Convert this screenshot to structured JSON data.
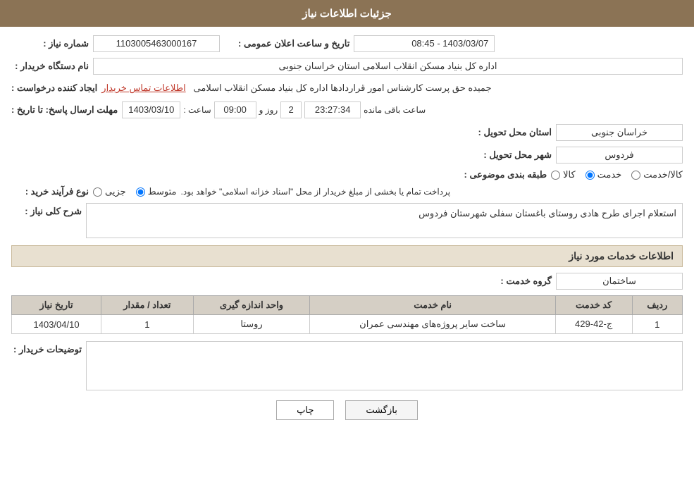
{
  "header": {
    "title": "جزئیات اطلاعات نیاز"
  },
  "fields": {
    "shomara_niaz_label": "شماره نیاز :",
    "shomara_niaz_value": "1103005463000167",
    "nam_dastgah_label": "نام دستگاه خریدار :",
    "nam_dastgah_value": "اداره کل بنیاد مسکن انقلاب اسلامی استان خراسان جنوبی",
    "ijad_konande_label": "ایجاد کننده درخواست :",
    "ijad_konande_value": "جمیده حق پرست کارشناس امور قراردادها اداره کل بنیاد مسکن انقلاب اسلامی",
    "ettelaat_tamas_label": "اطلاعات تماس خریدار",
    "tarikh_elan_label": "تاریخ و ساعت اعلان عمومی :",
    "tarikh_elan_value": "1403/03/07 - 08:45",
    "mohlat_label": "مهلت ارسال پاسخ: تا تاریخ :",
    "mohlat_date": "1403/03/10",
    "mohlat_saat_label": "ساعت :",
    "mohlat_saat": "09:00",
    "mohlat_rooz_label": "روز و",
    "mohlat_rooz": "2",
    "mohlat_baqi_label": "ساعت باقی مانده",
    "mohlat_baqi": "23:27:34",
    "ostan_label": "استان محل تحویل :",
    "ostan_value": "خراسان جنوبی",
    "shahr_label": "شهر محل تحویل :",
    "shahr_value": "فردوس",
    "tabaqe_label": "طبقه بندی موضوعی :",
    "tabaqe_options": [
      "کالا",
      "خدمت",
      "کالا/خدمت"
    ],
    "tabaqe_selected": "خدمت",
    "noع_farayand_label": "نوع فرآیند خرید :",
    "noع_farayand_options": [
      "جزیی",
      "متوسط"
    ],
    "noع_farayand_selected": "متوسط",
    "noع_farayand_desc": "پرداخت تمام یا بخشی از مبلغ خریدار از محل \"اسناد خزانه اسلامی\" خواهد بود.",
    "sharh_label": "شرح کلی نیاز :",
    "sharh_value": "استعلام اجرای طرح هادی روستای باغستان سفلی شهرستان فردوس",
    "khadamat_section": "اطلاعات خدمات مورد نیاز",
    "goroh_label": "گروه خدمت :",
    "goroh_value": "ساختمان",
    "table": {
      "headers": [
        "ردیف",
        "کد خدمت",
        "نام خدمت",
        "واحد اندازه گیری",
        "تعداد / مقدار",
        "تاریخ نیاز"
      ],
      "rows": [
        {
          "radif": "1",
          "kod": "ج-42-429",
          "nam": "ساخت سایر پروژه‌های مهندسی عمران",
          "vahed": "روستا",
          "tedad": "1",
          "tarikh": "1403/04/10"
        }
      ]
    },
    "توضیحات_label": "توضیحات خریدار :",
    "توضیحات_value": "",
    "btn_print": "چاپ",
    "btn_back": "بازگشت"
  }
}
